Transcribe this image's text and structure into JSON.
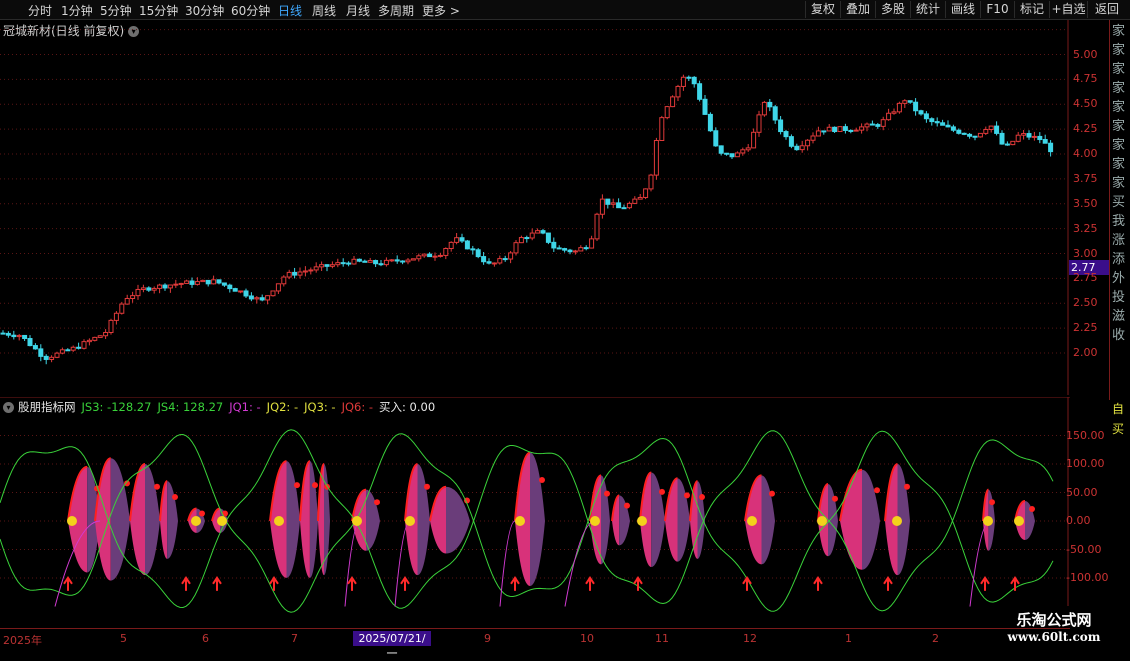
{
  "topbar": {
    "left_tabs": [
      {
        "label": "分时",
        "active": false
      },
      {
        "label": "1分钟",
        "active": false
      },
      {
        "label": "5分钟",
        "active": false
      },
      {
        "label": "15分钟",
        "active": false
      },
      {
        "label": "30分钟",
        "active": false
      },
      {
        "label": "60分钟",
        "active": false
      },
      {
        "label": "日线",
        "active": true
      },
      {
        "label": "周线",
        "active": false
      },
      {
        "label": "月线",
        "active": false
      },
      {
        "label": "多周期",
        "active": false
      },
      {
        "label": "更多 >",
        "active": false
      }
    ],
    "right_buttons": [
      "复权",
      "叠加",
      "多股",
      "统计",
      "画线",
      "F10",
      "标记",
      "+自选",
      "返回"
    ]
  },
  "main_chart": {
    "title": "冠城新材(日线 前复权)",
    "current_price_label": "2.77",
    "price_ticks": [
      "5.00",
      "4.75",
      "4.50",
      "4.25",
      "4.00",
      "3.75",
      "3.50",
      "3.25",
      "3.00",
      "2.75",
      "2.50",
      "2.25",
      "2.00"
    ]
  },
  "indicator": {
    "name": "股朋指标网",
    "values": [
      {
        "text": "JS3: -128.27",
        "color": "#39d23a"
      },
      {
        "text": "JS4: 128.27",
        "color": "#39d23a"
      },
      {
        "text": "JQ1: -",
        "color": "#d23ad2"
      },
      {
        "text": "JQ2: -",
        "color": "#e0e040"
      },
      {
        "text": "JQ3: -",
        "color": "#e0e040"
      },
      {
        "text": "JQ6: -",
        "color": "#e03a3a"
      },
      {
        "text": "买入: 0.00",
        "color": "#e8e8e8"
      }
    ],
    "ticks": [
      "150.00",
      "100.00",
      "50.00",
      "0.00",
      "-50.00",
      "-100.00"
    ]
  },
  "x_axis": {
    "labels": [
      "2025年",
      "5",
      "6",
      "7",
      "9",
      "10",
      "11",
      "12",
      "1",
      "2"
    ],
    "cursor_date": "2025/07/21/一"
  },
  "right_panel_text": "家家家家家家家家家买我涨添外投滋收",
  "right_panel_lower": "自买",
  "watermark": {
    "line1": "乐淘公式网",
    "line2": "www.60lt.com"
  },
  "colors": {
    "up": "#e03a3a",
    "down": "#3fd6e8",
    "band_magenta": "#d8327a",
    "band_purple": "#6a3d7a",
    "green_line": "#3ad23a",
    "magenta_line": "#d23ad2",
    "dot": "#f3d21b",
    "arrow": "#ff2a2a"
  }
}
